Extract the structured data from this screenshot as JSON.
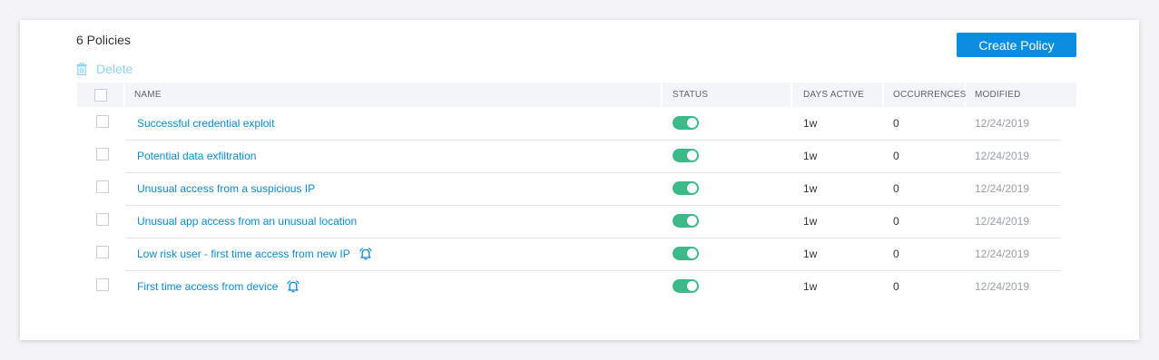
{
  "header": {
    "policy_count": "6 Policies",
    "create_label": "Create Policy",
    "delete_label": "Delete"
  },
  "table": {
    "columns": [
      "NAME",
      "STATUS",
      "DAYS ACTIVE",
      "OCCURRENCES",
      "MODIFIED"
    ],
    "rows": [
      {
        "name": "Successful credential exploit",
        "status": "on",
        "days_active": "1w",
        "occurrences": "0",
        "modified": "12/24/2019",
        "has_notify_icon": false
      },
      {
        "name": "Potential data exfiltration",
        "status": "on",
        "days_active": "1w",
        "occurrences": "0",
        "modified": "12/24/2019",
        "has_notify_icon": false
      },
      {
        "name": "Unusual access from a suspicious IP",
        "status": "on",
        "days_active": "1w",
        "occurrences": "0",
        "modified": "12/24/2019",
        "has_notify_icon": false
      },
      {
        "name": "Unusual app access from an unusual location",
        "status": "on",
        "days_active": "1w",
        "occurrences": "0",
        "modified": "12/24/2019",
        "has_notify_icon": false
      },
      {
        "name": "Low risk user - first time access from new IP",
        "status": "on",
        "days_active": "1w",
        "occurrences": "0",
        "modified": "12/24/2019",
        "has_notify_icon": true
      },
      {
        "name": "First time access from device",
        "status": "on",
        "days_active": "1w",
        "occurrences": "0",
        "modified": "12/24/2019",
        "has_notify_icon": true
      }
    ]
  },
  "icons": {
    "delete": "trash-icon",
    "notify": "bell-refresh-icon"
  },
  "colors": {
    "accent": "#0b8ee0",
    "link": "#0a8bd4",
    "toggle_on": "#3cba8a",
    "delete_disabled": "#8fd3f2"
  }
}
